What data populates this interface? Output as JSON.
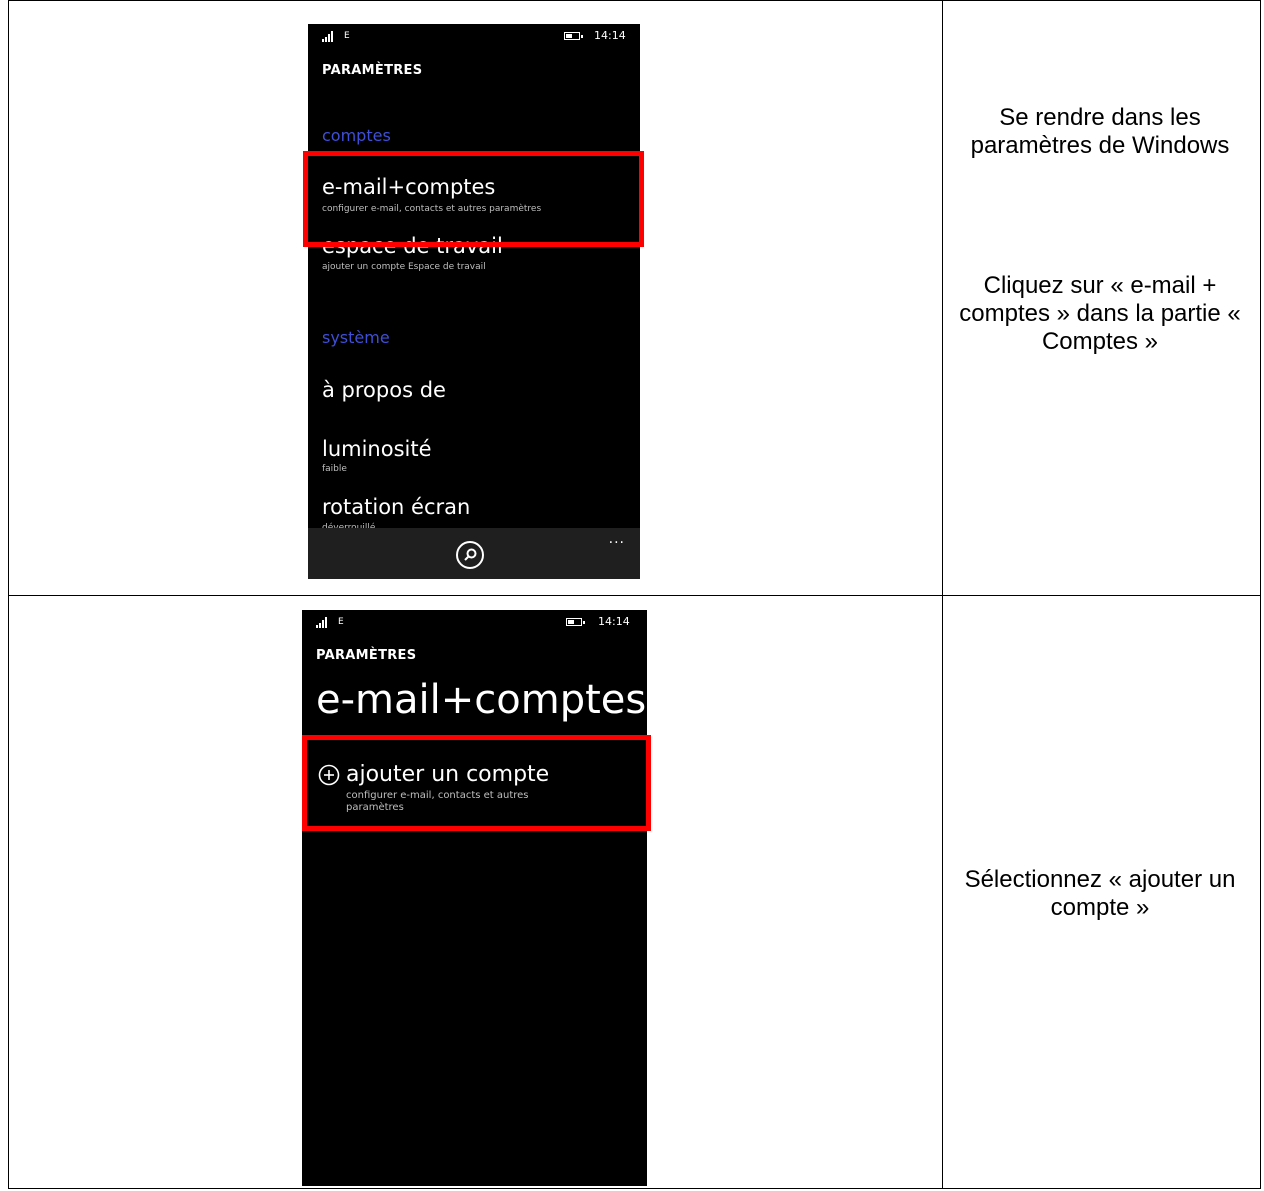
{
  "row1": {
    "phone": {
      "network": "E",
      "time": "14:14",
      "page_title": "PARAMÈTRES",
      "section_accounts": "comptes",
      "email_accounts": {
        "label": "e-mail+comptes",
        "sub": "configurer e-mail, contacts et autres paramètres"
      },
      "workspace": {
        "label": "espace de travail",
        "sub": "ajouter un compte Espace de travail"
      },
      "section_system": "système",
      "about": {
        "label": "à propos de"
      },
      "brightness": {
        "label": "luminosité",
        "sub": "faible"
      },
      "rotation": {
        "label": "rotation écran",
        "sub": "déverrouillé"
      },
      "more": "..."
    },
    "instruction_1": "Se rendre dans les paramètres de Windows",
    "instruction_2": "Cliquez sur « e-mail + comptes » dans la partie « Comptes »"
  },
  "row2": {
    "phone": {
      "network": "E",
      "time": "14:14",
      "page_title": "PARAMÈTRES",
      "big_title": "e-mail+comptes",
      "add_account": {
        "label": "ajouter un compte",
        "sub": "configurer e-mail, contacts et autres paramètres"
      }
    },
    "instruction": "Sélectionnez « ajouter un compte »"
  },
  "colors": {
    "highlight": "#ff0000",
    "accent": "#3f4fd6",
    "phone_bg": "#000000"
  }
}
